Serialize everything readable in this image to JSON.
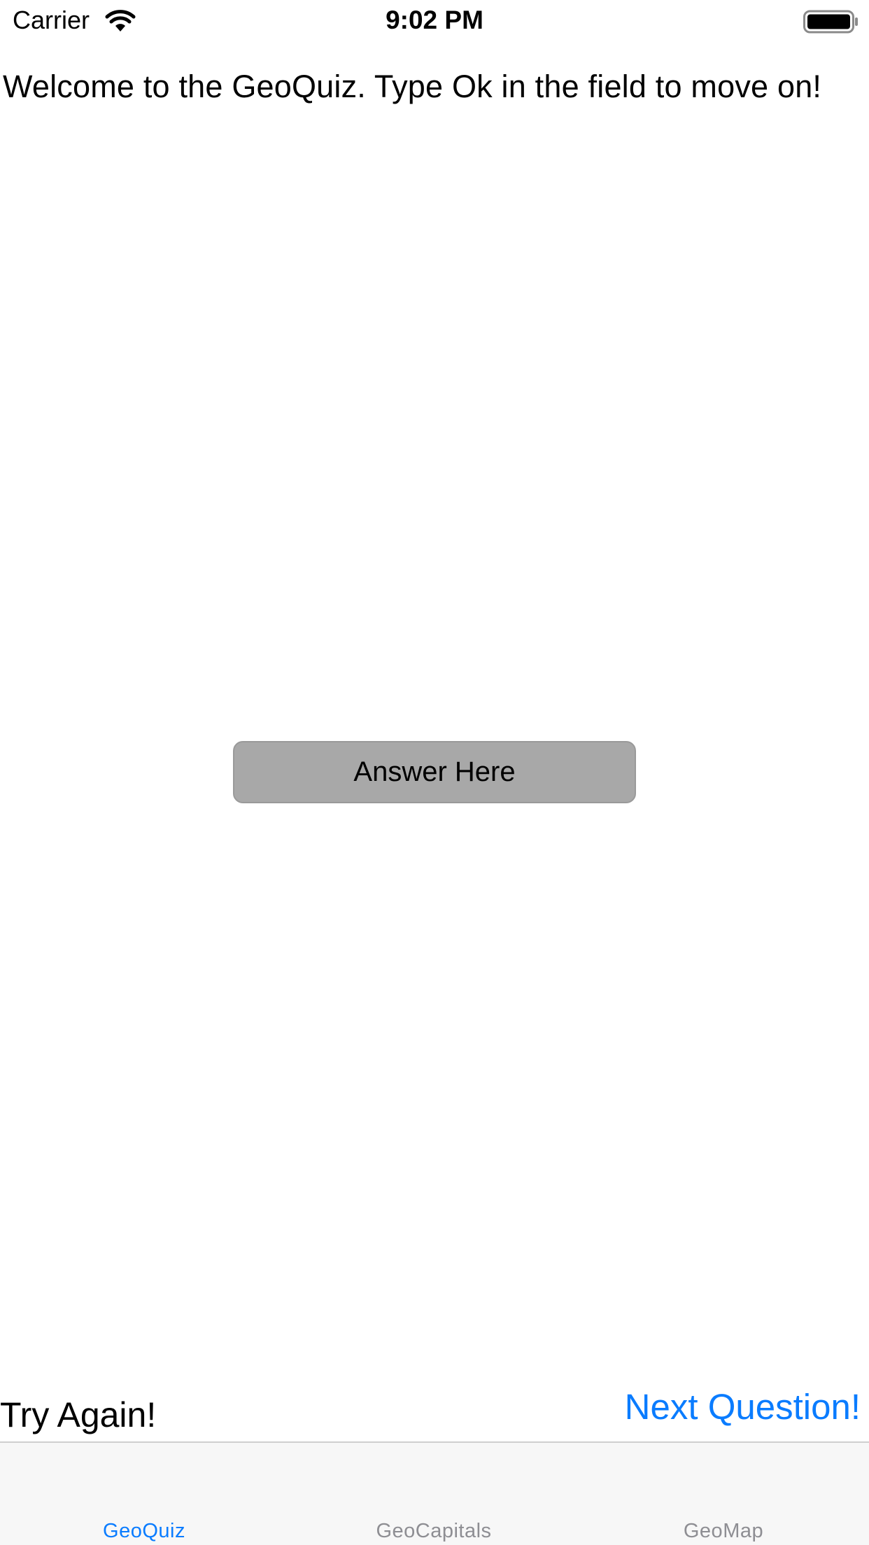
{
  "status_bar": {
    "carrier": "Carrier",
    "time": "9:02 PM",
    "wifi_icon": "wifi-icon",
    "battery_icon": "battery-full-icon"
  },
  "main": {
    "prompt": "Welcome to the GeoQuiz. Type Ok in the field to move on!",
    "answer_placeholder": "Answer Here",
    "answer_value": "",
    "feedback": "Try Again!",
    "next_label": "Next Question!"
  },
  "tab_bar": {
    "tabs": [
      {
        "label": "GeoQuiz",
        "active": true
      },
      {
        "label": "GeoCapitals",
        "active": false
      },
      {
        "label": "GeoMap",
        "active": false
      }
    ]
  },
  "colors": {
    "accent": "#0a7cff",
    "inactive_tab": "#8e8e93",
    "field_background": "#a8a8a8",
    "tab_bar_background": "#f7f7f7"
  }
}
